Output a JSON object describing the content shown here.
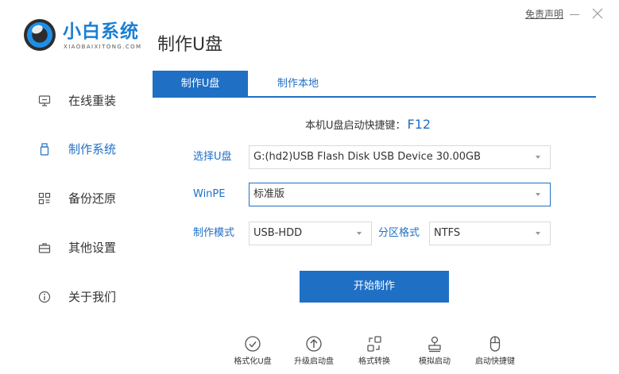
{
  "brand": {
    "name": "小白系统",
    "subtitle": "XIAOBAIXITONG.COM"
  },
  "page_title": "制作U盘",
  "window": {
    "disclaimer": "免责声明"
  },
  "sidebar": {
    "items": [
      {
        "label": "在线重装",
        "icon": "monitor-icon",
        "active": false
      },
      {
        "label": "制作系统",
        "icon": "usb-drive-icon",
        "active": true
      },
      {
        "label": "备份还原",
        "icon": "grid-icon",
        "active": false
      },
      {
        "label": "其他设置",
        "icon": "briefcase-icon",
        "active": false
      },
      {
        "label": "关于我们",
        "icon": "info-icon",
        "active": false
      }
    ]
  },
  "tabs": [
    {
      "label": "制作U盘",
      "active": true
    },
    {
      "label": "制作本地",
      "active": false
    }
  ],
  "form": {
    "hotkey_label": "本机U盘启动快捷键：",
    "hotkey_value": "F12",
    "usb_label": "选择U盘",
    "usb_value": "G:(hd2)USB Flash Disk USB Device 30.00GB",
    "winpe_label": "WinPE",
    "winpe_value": "标准版",
    "mode_label": "制作模式",
    "mode_value": "USB-HDD",
    "partition_label": "分区格式",
    "partition_value": "NTFS",
    "start_button": "开始制作"
  },
  "tools": [
    {
      "label": "格式化U盘",
      "icon": "check-circle-icon"
    },
    {
      "label": "升级启动盘",
      "icon": "arrow-up-circle-icon"
    },
    {
      "label": "格式转换",
      "icon": "convert-icon"
    },
    {
      "label": "模拟启动",
      "icon": "stamp-icon"
    },
    {
      "label": "启动快捷键",
      "icon": "mouse-icon"
    }
  ],
  "colors": {
    "accent": "#1f6fc5",
    "brand": "#1a7fd4",
    "border": "#d9d9d9"
  }
}
